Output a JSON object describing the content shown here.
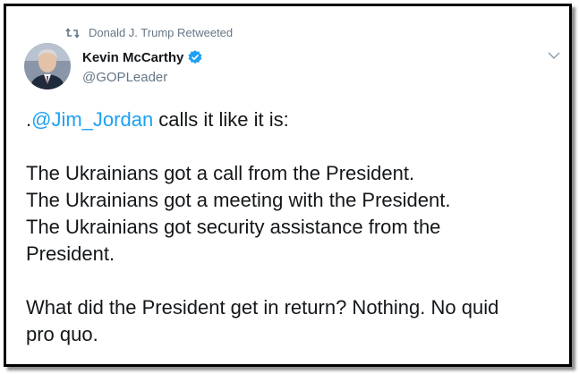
{
  "retweet": {
    "text": "Donald J. Trump Retweeted",
    "icon": "retweet-icon"
  },
  "author": {
    "name": "Kevin McCarthy",
    "handle": "@GOPLeader",
    "verified": true,
    "verified_color": "#1da1f2"
  },
  "tweet": {
    "prefix": ".",
    "mention": "@Jim_Jordan",
    "line1_rest": " calls it like it is:",
    "line2": "The Ukrainians got a call from the President.",
    "line3": "The Ukrainians got a meeting with the President.",
    "line4": "The Ukrainians got security assistance from the",
    "line5": "President.",
    "line6": "What did the President get in return? Nothing. No quid",
    "line7": "pro quo."
  },
  "colors": {
    "mention": "#1da1f2",
    "muted": "#657786",
    "text": "#14171a"
  }
}
